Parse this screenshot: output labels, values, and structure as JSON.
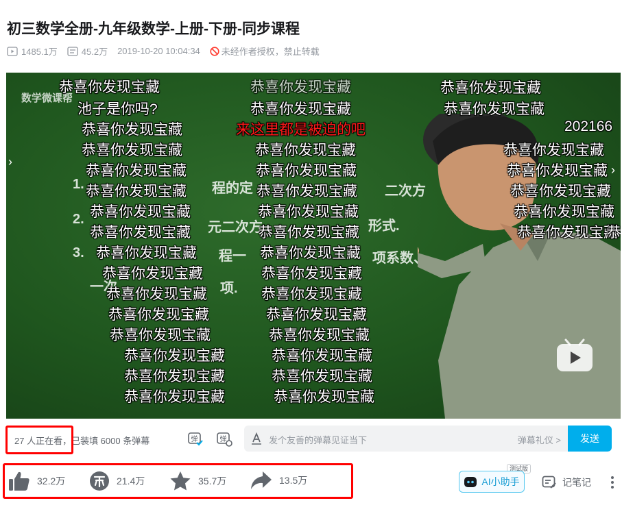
{
  "title": "初三数学全册-九年级数学-上册-下册-同步课程",
  "meta": {
    "play_count": "1485.1万",
    "danmaku_count": "45.2万",
    "publish_time": "2019-10-20 10:04:34",
    "copyright_notice": "未经作者授权，禁止转载"
  },
  "player": {
    "watermark": "数学微课帮",
    "board_lines": [
      "1.",
      "程的定",
      "二次方",
      "2.",
      "元二次方",
      "形式.",
      "3.",
      "程一",
      "项系数、",
      "一次",
      "项."
    ],
    "timestamp_text": "202166",
    "danmaku": [
      "恭喜你发现宝藏",
      "恭喜你发现宝藏",
      "恭喜你发现宝藏",
      "池子是你吗?",
      "恭喜你发现宝藏",
      "恭喜你发现宝藏",
      "恭喜你发现宝藏",
      "来这里都是被迫的吧",
      "恭喜你发现宝藏",
      "恭喜你发现宝藏",
      "恭喜你发现宝藏",
      "恭喜你发现宝藏",
      "恭喜你发现宝藏",
      "恭喜你发现宝藏",
      "恭喜你发现宝藏",
      "恭喜你发现宝藏",
      "恭喜你发现宝藏",
      "恭喜你发现宝藏",
      "恭喜你发现宝藏",
      "恭喜你发现宝藏",
      "恭喜你发现宝藏",
      "恭喜你发现宝藏",
      "恭喜你发现宝藏",
      "恭喜你发现宝藏",
      "恭喜你发现宝藏",
      "恭喜你发现宝藏",
      "恭喜你发现宝藏",
      "恭喜你发现宝藏",
      "恭喜你发现宝藏",
      "恭喜你发现宝藏",
      "恭喜你发现宝藏",
      "恭喜你发现宝藏",
      "恭喜你发现宝藏",
      "恭喜你发现宝藏",
      "恭喜你发现宝藏",
      "恭喜你发现宝藏",
      "恭喜你发现宝藏",
      "恭喜你发现宝藏",
      "恭喜你发现宝藏",
      "恭喜你发现宝藏"
    ]
  },
  "sendbar": {
    "viewers": "27 人正在看，已装填 6000 条弹幕",
    "input_placeholder": "发个友善的弹幕见证当下",
    "etiquette": "弹幕礼仪 >",
    "send_label": "发送"
  },
  "actions": {
    "like_count": "32.2万",
    "coin_count": "21.4万",
    "favorite_count": "35.7万",
    "share_count": "13.5万",
    "ai_label": "AI小助手",
    "beta_label": "测试版",
    "notes_label": "记笔记"
  },
  "colors": {
    "accent": "#00aeec",
    "highlight_box": "#ff0000",
    "board_green": "#1f561e",
    "danmaku_red": "#ff1a1a"
  }
}
